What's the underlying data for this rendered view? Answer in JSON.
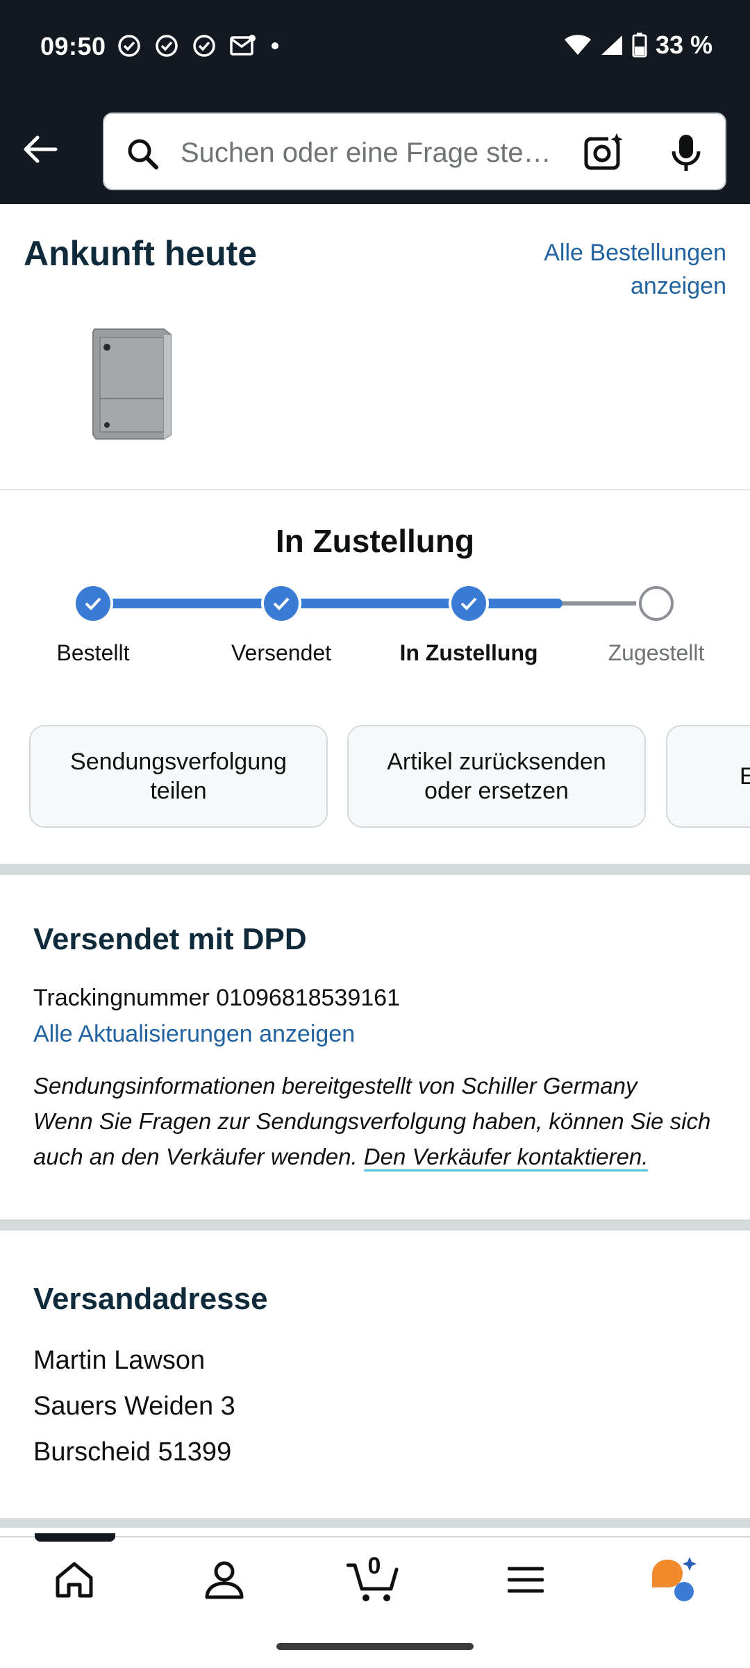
{
  "status_bar": {
    "time": "09:50",
    "battery": "33 %",
    "icons": [
      "check-circle-icon",
      "check-circle-icon",
      "check-circle-icon",
      "mail-icon",
      "dot-icon",
      "wifi-icon",
      "signal-icon",
      "battery-icon"
    ]
  },
  "search": {
    "placeholder": "Suchen oder eine Frage ste…"
  },
  "arrival": {
    "title": "Ankunft heute",
    "all_orders_line1": "Alle Bestellungen",
    "all_orders_line2": "anzeigen"
  },
  "progress": {
    "title": "In Zustellung",
    "steps": [
      {
        "label": "Bestellt",
        "state": "done"
      },
      {
        "label": "Versendet",
        "state": "done"
      },
      {
        "label": "In Zustellung",
        "state": "current"
      },
      {
        "label": "Zugestellt",
        "state": "pending"
      }
    ],
    "accent_color": "#3a7bd5"
  },
  "actions": [
    {
      "line1": "Sendungsverfolgung",
      "line2": "teilen"
    },
    {
      "line1": "Artikel zurücksenden",
      "line2": "oder ersetzen"
    },
    {
      "line1": "E",
      "line2": ""
    }
  ],
  "shipping": {
    "title": "Versendet mit DPD",
    "tracking": "Trackingnummer 01096818539161",
    "updates_link": "Alle Aktualisierungen anzeigen",
    "info_line1": "Sendungsinformationen bereitgestellt von Schiller Germany",
    "info_line2": "Wenn Sie Fragen zur Sendungsverfolgung haben, können Sie sich",
    "info_line3": "auch an den Verkäufer wenden.",
    "contact_link": "Den Verkäufer kontaktieren."
  },
  "address": {
    "title": "Versandadresse",
    "name": "Martin Lawson",
    "street": "Sauers Weiden 3",
    "city": "Burscheid 51399"
  },
  "nav": {
    "cart_count": "0",
    "items": [
      "home-icon",
      "account-icon",
      "cart-icon",
      "menu-icon",
      "rufus-icon"
    ]
  }
}
